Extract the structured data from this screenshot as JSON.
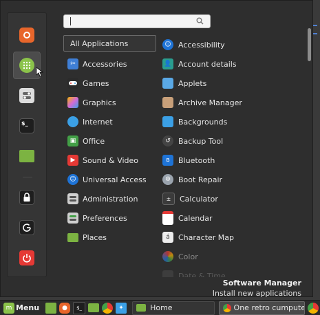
{
  "search": {
    "placeholder": "",
    "value": ""
  },
  "favorites": [
    {
      "name": "firefox-icon",
      "color": "#e8662b",
      "glyph": "●"
    },
    {
      "name": "software-manager-icon",
      "color": "#8bc34a",
      "glyph": "⋮⋮"
    },
    {
      "name": "settings-toggle-icon",
      "color": "#dddddd",
      "glyph": "⊜"
    },
    {
      "name": "terminal-icon",
      "color": "#222222",
      "glyph": "$_"
    },
    {
      "name": "files-folder-icon",
      "color": "#7cb342",
      "glyph": ""
    },
    {
      "name": "lock-icon",
      "color": "#222222",
      "glyph": "🔒"
    },
    {
      "name": "logout-icon",
      "color": "#222222",
      "glyph": "⟳"
    },
    {
      "name": "power-icon",
      "color": "#e53935",
      "glyph": "⏻"
    }
  ],
  "categories": [
    {
      "label": "All Applications",
      "icon": "",
      "color": ""
    },
    {
      "label": "Accessories",
      "icon": "scissors-icon",
      "color": "#3f7fd6"
    },
    {
      "label": "Games",
      "icon": "gamepad-icon",
      "color": "#2b2b2b"
    },
    {
      "label": "Graphics",
      "icon": "graphics-icon",
      "color": "#d36ad6"
    },
    {
      "label": "Internet",
      "icon": "cloud-icon",
      "color": "#3ba0e6"
    },
    {
      "label": "Office",
      "icon": "office-icon",
      "color": "#43a047"
    },
    {
      "label": "Sound & Video",
      "icon": "play-icon",
      "color": "#e53935"
    },
    {
      "label": "Universal Access",
      "icon": "accessibility-icon",
      "color": "#1e73d6"
    },
    {
      "label": "Administration",
      "icon": "admin-icon",
      "color": "#cfcfcf"
    },
    {
      "label": "Preferences",
      "icon": "preferences-icon",
      "color": "#cfcfcf"
    },
    {
      "label": "Places",
      "icon": "folder-icon",
      "color": "#7cb342"
    }
  ],
  "apps": [
    {
      "label": "Accessibility",
      "icon": "accessibility-icon",
      "color": "#1e73d6",
      "state": ""
    },
    {
      "label": "Account details",
      "icon": "account-icon",
      "color": "#2a9d8f",
      "state": ""
    },
    {
      "label": "Applets",
      "icon": "applets-icon",
      "color": "#5aa9e6",
      "state": ""
    },
    {
      "label": "Archive Manager",
      "icon": "archive-icon",
      "color": "#c8a07a",
      "state": ""
    },
    {
      "label": "Backgrounds",
      "icon": "backgrounds-icon",
      "color": "#3ba0e6",
      "state": ""
    },
    {
      "label": "Backup Tool",
      "icon": "backup-icon",
      "color": "#444444",
      "state": ""
    },
    {
      "label": "Bluetooth",
      "icon": "bluetooth-icon",
      "color": "#1e73d6",
      "state": ""
    },
    {
      "label": "Boot Repair",
      "icon": "boot-repair-icon",
      "color": "#9aa3ad",
      "state": ""
    },
    {
      "label": "Calculator",
      "icon": "calculator-icon",
      "color": "#3b3b3b",
      "state": ""
    },
    {
      "label": "Calendar",
      "icon": "calendar-icon",
      "color": "#e53935",
      "state": ""
    },
    {
      "label": "Character Map",
      "icon": "charmap-icon",
      "color": "#eeeeee",
      "state": ""
    },
    {
      "label": "Color",
      "icon": "color-icon",
      "color": "#7c5a9e",
      "state": "dim"
    },
    {
      "label": "Date & Time",
      "icon": "datetime-icon",
      "color": "#555555",
      "state": "faint"
    }
  ],
  "info": {
    "title": "Software Manager",
    "description": "Install new applications"
  },
  "panel": {
    "menu_label": "Menu",
    "tasks": [
      {
        "label": "Home",
        "icon": "folder-icon",
        "color": "#7cb342",
        "active": false
      },
      {
        "label": "One retro cumputers...",
        "icon": "chrome-icon",
        "color": "#e8b43a",
        "active": true
      }
    ]
  }
}
